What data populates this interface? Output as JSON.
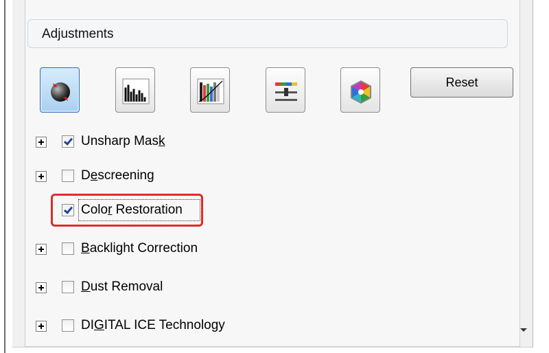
{
  "group": {
    "title": "Adjustments"
  },
  "toolbar": {
    "buttons": [
      {
        "name": "auto-exposure-icon"
      },
      {
        "name": "histogram-icon"
      },
      {
        "name": "tone-curve-icon"
      },
      {
        "name": "brightness-contrast-icon"
      },
      {
        "name": "color-palette-icon"
      }
    ],
    "reset_label": "Reset"
  },
  "options": {
    "unsharp": {
      "prefix": "Unsharp Mas",
      "underline": "k",
      "suffix": "",
      "checked": true
    },
    "descreening": {
      "prefix": "D",
      "underline": "e",
      "suffix": "screening",
      "checked": false
    },
    "color_restoration": {
      "prefix": "Colo",
      "underline": "r",
      "suffix": " Restoration",
      "checked": true
    },
    "backlight": {
      "prefix": "",
      "underline": "B",
      "suffix": "acklight Correction",
      "checked": false
    },
    "dust": {
      "prefix": "",
      "underline": "D",
      "suffix": "ust Removal",
      "checked": false
    },
    "digital_ice": {
      "prefix": "DI",
      "underline": "G",
      "suffix": "ITAL ICE Technology",
      "checked": false
    }
  },
  "colors": {
    "highlight": "#e02b2b",
    "check": "#21459b",
    "active_button": "#a8d0f1"
  }
}
